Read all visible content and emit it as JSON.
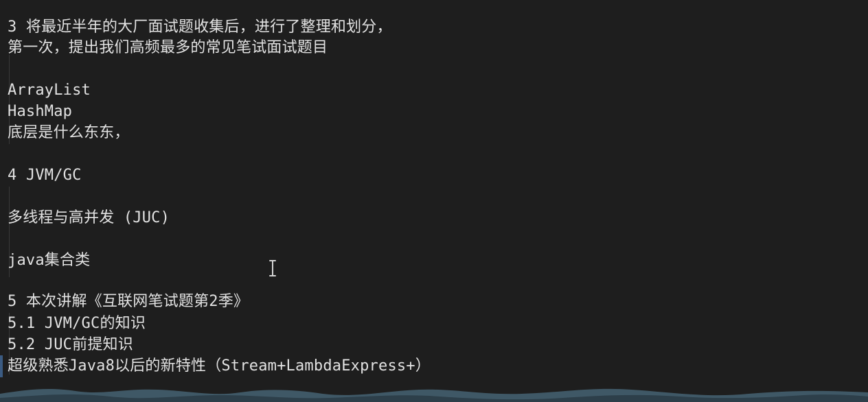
{
  "editor": {
    "lines": [
      "3 将最近半年的大厂面试题收集后，进行了整理和划分，",
      "  第一次，提出我们高频最多的常见笔试面试题目",
      "",
      "    ArrayList",
      "    HashMap",
      "    底层是什么东东，",
      "",
      "4  JVM/GC",
      "",
      "    多线程与高并发 (JUC)",
      "",
      "    java集合类",
      "",
      "5 本次讲解《互联网笔试题第2季》",
      "    5.1 JVM/GC的知识",
      "    5.2 JUC前提知识",
      "    超级熟悉Java8以后的新特性（Stream+LambdaExpress+）"
    ]
  },
  "colors": {
    "background": "#1e1e1e",
    "text": "#e2e2e2",
    "guide": "#3a3a3a",
    "gutter_accent": "#3b5b82"
  },
  "icons": {
    "cursor": "text-cursor-icon"
  }
}
